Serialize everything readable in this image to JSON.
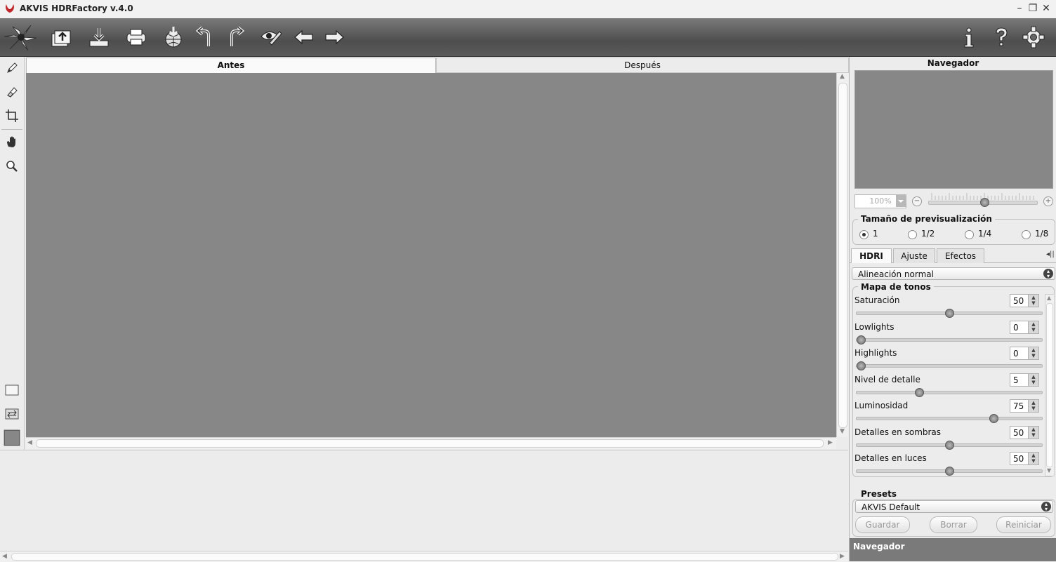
{
  "window": {
    "title": "AKVIS HDRFactory v.4.0",
    "controls": [
      "–",
      "❐",
      "✕"
    ]
  },
  "toolbar": {
    "buttons": [
      "logo-icon",
      "open-icon",
      "save-icon",
      "print-icon",
      "publish-icon",
      "undo-icon",
      "redo-icon",
      "preview-icon",
      "back-icon",
      "forward-icon"
    ],
    "right_buttons": [
      "info-icon",
      "help-icon",
      "settings-icon"
    ]
  },
  "tabs": {
    "before": "Antes",
    "after": "Después"
  },
  "navigator": {
    "title": "Navegador",
    "zoom": "100%",
    "zoom_minus": "−",
    "zoom_plus": "+",
    "zoom_level": 0.5
  },
  "preview_size": {
    "label": "Tamaño de previsualización",
    "options": [
      "1",
      "1/2",
      "1/4",
      "1/8"
    ],
    "selected": "1"
  },
  "panel_tabs": [
    "HDRI",
    "Ajuste",
    "Efectos"
  ],
  "panel_collapse": "◂||",
  "alignment": {
    "value": "Alineación normal"
  },
  "tone_map": {
    "label": "Mapa de tonos",
    "params": [
      {
        "label": "Saturación",
        "value": "50",
        "level": 0.5
      },
      {
        "label": "Lowlights",
        "value": "0",
        "level": 0.0
      },
      {
        "label": "Highlights",
        "value": "0",
        "level": 0.0
      },
      {
        "label": "Nivel de detalle",
        "value": "5",
        "level": 0.33
      },
      {
        "label": "Luminosidad",
        "value": "75",
        "level": 0.75
      },
      {
        "label": "Detalles en sombras",
        "value": "50",
        "level": 0.5
      },
      {
        "label": "Detalles en luces",
        "value": "50",
        "level": 0.5
      }
    ]
  },
  "presets": {
    "label": "Presets",
    "value": "AKVIS Default",
    "save": "Guardar",
    "delete": "Borrar",
    "reset": "Reiniciar"
  },
  "bottom_panel": {
    "title": "Navegador"
  }
}
